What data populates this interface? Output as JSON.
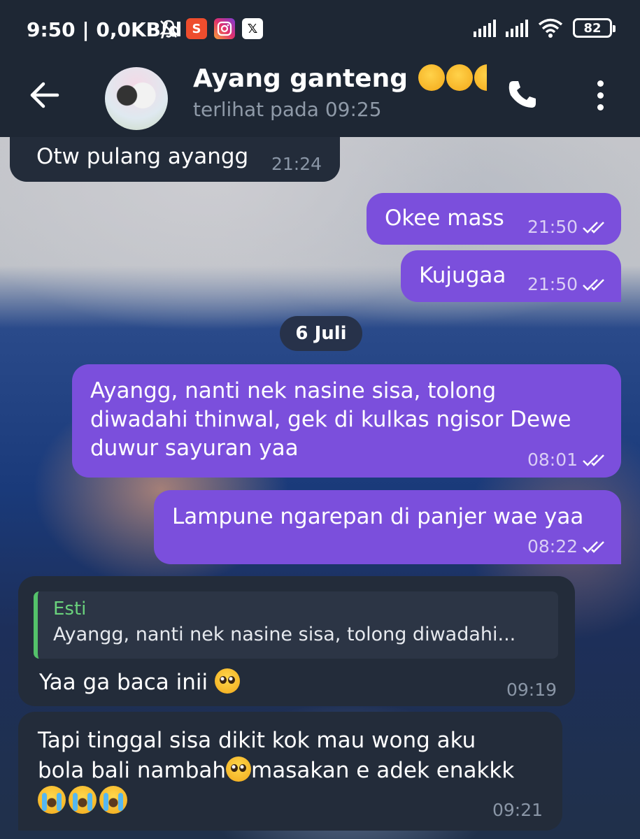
{
  "status_bar": {
    "time": "9:50 | 0,0KB/d",
    "battery": "82",
    "icons": [
      "bell-off-icon",
      "shopee-icon",
      "instagram-icon",
      "x-icon",
      "signal-icon",
      "signal-icon",
      "wifi-icon",
      "battery-icon"
    ]
  },
  "header": {
    "title": "Ayang ganteng",
    "title_emojis": [
      "kissing-face-icon",
      "kissing-face-icon",
      "kissing-face-icon"
    ],
    "subtitle": "terlihat pada  09:25"
  },
  "colors": {
    "outgoing_bubble": "#7b4fdc",
    "incoming_bubble": "#232c3a",
    "header_bg": "#1e2734",
    "reply_accent": "#54c26a"
  },
  "messages": [
    {
      "direction": "incoming",
      "text": "Otw pulang ayangg",
      "time": "21:24"
    },
    {
      "direction": "outgoing",
      "text": "Okee mass",
      "time": "21:50",
      "read": true
    },
    {
      "direction": "outgoing",
      "text": "Kujugaa",
      "time": "21:50",
      "read": true
    },
    {
      "direction": "outgoing",
      "text_lines": [
        "Ayangg, nanti nek nasine sisa, tolong",
        "diwadahi thinwal, gek di kulkas ngisor Dewe",
        "duwur sayuran yaa"
      ],
      "time": "08:01",
      "read": true
    },
    {
      "direction": "outgoing",
      "text": "Lampune ngarepan di panjer wae yaa",
      "time": "08:22",
      "read": true
    },
    {
      "direction": "incoming",
      "reply_to": {
        "name": "Esti",
        "text": "Ayangg, nanti nek nasine sisa, tolong diwadahi..."
      },
      "text": "Yaa ga baca inii",
      "time": "09:19"
    },
    {
      "direction": "incoming",
      "text_lines": [
        "Tapi tinggal sisa dikit kok mau wong aku",
        "bola bali nambah",
        "masakan e adek enakkk"
      ],
      "time": "09:21"
    }
  ],
  "date_separator": "6 Juli"
}
